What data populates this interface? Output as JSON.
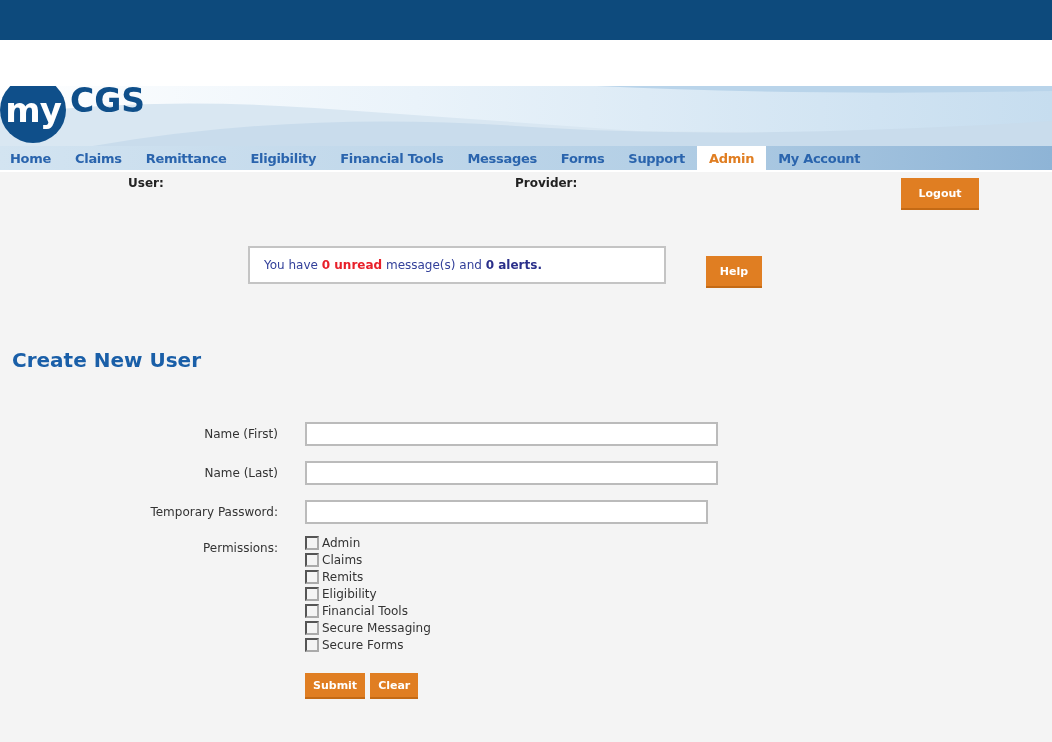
{
  "logo": {
    "badge": "my",
    "name": "CGS"
  },
  "nav": [
    {
      "label": "Home",
      "selected": false
    },
    {
      "label": "Claims",
      "selected": false
    },
    {
      "label": "Remittance",
      "selected": false
    },
    {
      "label": "Eligibility",
      "selected": false
    },
    {
      "label": "Financial Tools",
      "selected": false
    },
    {
      "label": "Messages",
      "selected": false
    },
    {
      "label": "Forms",
      "selected": false
    },
    {
      "label": "Support",
      "selected": false
    },
    {
      "label": "Admin",
      "selected": true
    },
    {
      "label": "My Account",
      "selected": false
    }
  ],
  "info": {
    "user_label": "User:",
    "provider_label": "Provider:",
    "logout": "Logout"
  },
  "message": [
    {
      "kind": "plain",
      "text": "You have "
    },
    {
      "kind": "unread",
      "text": "0 unread"
    },
    {
      "kind": "plain",
      "text": " message(s) and "
    },
    {
      "kind": "count",
      "text": "0 alerts."
    }
  ],
  "help": "Help",
  "form": {
    "title": "Create New User",
    "fields": [
      {
        "label": "Name (First)",
        "kind": "wide"
      },
      {
        "label": "Name (Last)",
        "kind": "wide"
      },
      {
        "label": "Temporary Password:",
        "kind": "narrow"
      }
    ],
    "permissions_label": "Permissions:",
    "permissions": [
      {
        "label": "Admin",
        "checked": false
      },
      {
        "label": "Claims",
        "checked": false
      },
      {
        "label": "Remits",
        "checked": false
      },
      {
        "label": "Eligibility",
        "checked": false
      },
      {
        "label": "Financial Tools",
        "checked": false
      },
      {
        "label": "Secure Messaging",
        "checked": false
      },
      {
        "label": "Secure Forms",
        "checked": false
      }
    ],
    "buttons": [
      "Submit",
      "Clear"
    ]
  }
}
